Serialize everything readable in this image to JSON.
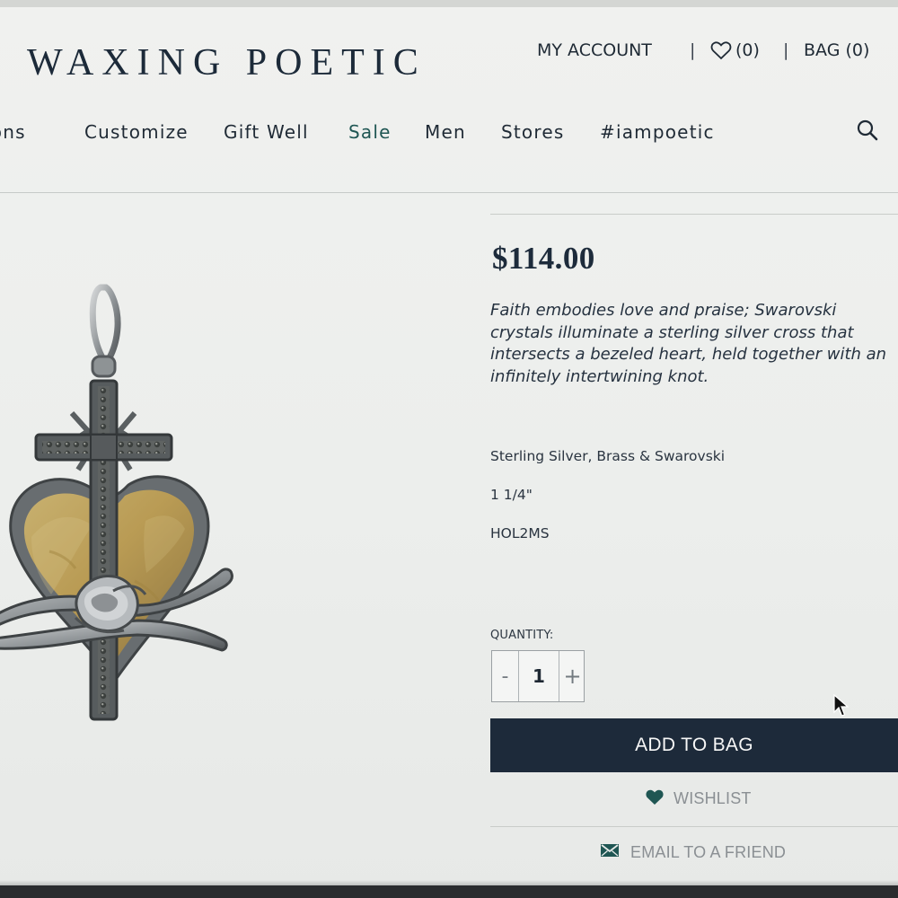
{
  "brand": "WAXING POETIC",
  "account": {
    "my_account": "MY ACCOUNT",
    "wishlist_count": "(0)",
    "bag": "BAG (0)",
    "separator": "|"
  },
  "nav": {
    "items": [
      "tions",
      "Customize",
      "Gift Well",
      "Sale",
      "Men",
      "Stores",
      "#iampoetic"
    ]
  },
  "product": {
    "price": "$114.00",
    "description": [
      "Faith embodies love and praise; Swarovski",
      "crystals illuminate a sterling silver cross that",
      "intersects a bezeled heart, held together with an",
      "infinitely intertwining knot."
    ],
    "materials": "Sterling Silver, Brass & Swarovski",
    "size": "1 1/4\"",
    "sku": "HOL2MS"
  },
  "quantity": {
    "label": "QUANTITY:",
    "minus": "-",
    "value": "1",
    "plus": "+"
  },
  "actions": {
    "add_to_bag": "ADD TO BAG",
    "wishlist": "WISHLIST",
    "email_friend": "EMAIL TO A FRIEND"
  },
  "colors": {
    "brand_dark": "#1d2a3a",
    "sale_green": "#1f5653",
    "icon_teal": "#1f5653"
  },
  "icons": {
    "wishlist_header": "heart-outline-icon",
    "search": "search-icon",
    "wishlist_button": "heart-filled-icon",
    "email": "envelope-icon",
    "cursor": "cursor-icon"
  }
}
